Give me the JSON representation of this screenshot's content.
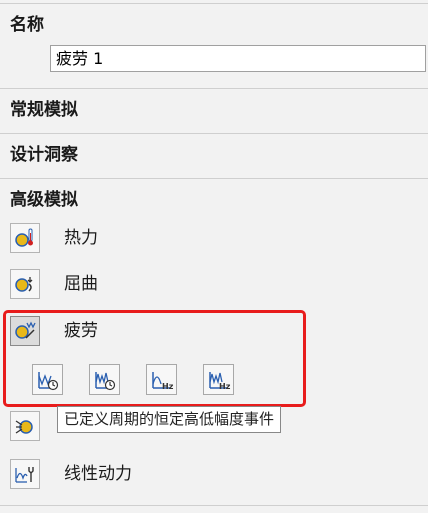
{
  "name_section": {
    "title": "名称",
    "value": "疲劳 1"
  },
  "sections": {
    "general": "常规模拟",
    "design_insight": "设计洞察",
    "advanced": "高级模拟"
  },
  "advanced_items": [
    {
      "label": "热力",
      "icon": "thermal-study-icon"
    },
    {
      "label": "屈曲",
      "icon": "buckling-study-icon"
    },
    {
      "label": "疲劳",
      "icon": "fatigue-study-icon",
      "selected": true
    },
    {
      "label": "",
      "icon": "drop-test-icon"
    },
    {
      "label": "线性动力",
      "icon": "linear-dynamic-icon"
    }
  ],
  "fatigue_options": [
    {
      "icon": "constant-amplitude-fatigue-icon"
    },
    {
      "icon": "variable-amplitude-fatigue-icon"
    },
    {
      "icon": "harmonic-fatigue-icon"
    },
    {
      "icon": "random-vibration-fatigue-icon"
    }
  ],
  "tooltip": "已定义周期的恒定高低幅度事件",
  "colors": {
    "highlight": "#e81c1c",
    "panel_bg": "#f2f2f2",
    "icon_blue": "#2a5fb0",
    "icon_yellow": "#e8b81a"
  }
}
